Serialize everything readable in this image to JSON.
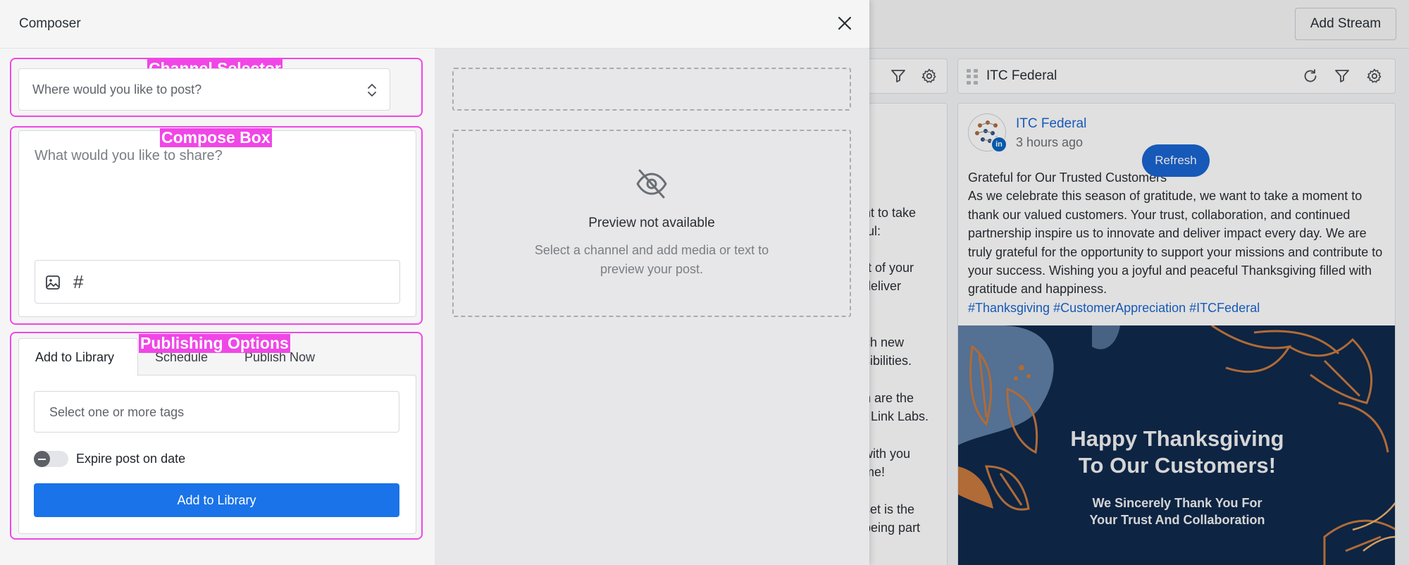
{
  "background": {
    "add_stream_label": "Add Stream",
    "column1": {
      "fragments": [
        "nt to take",
        "ful:",
        "rt of your",
        "deliver",
        "ch new",
        "sibilities.",
        "n are the",
        "f Link Labs.",
        "with you",
        "me!",
        "set is the",
        "being part"
      ]
    },
    "column2": {
      "title": "ITC Federal",
      "post": {
        "author": "ITC Federal",
        "time": "3 hours ago",
        "title": "Grateful for Our Trusted Customers",
        "body": "As we celebrate this season of gratitude, we want to take a moment to thank our valued customers. Your trust, collaboration, and continued partnership inspire us to innovate and deliver impact every day. We are truly grateful for the opportunity to support your missions and contribute to your success. Wishing you a joyful and peaceful Thanksgiving filled with gratitude and happiness.",
        "hashtags": "#Thanksgiving #CustomerAppreciation #ITCFederal",
        "image_line1": "Happy Thanksgiving",
        "image_line2": "To Our Customers!",
        "image_line3": "We Sincerely Thank You For",
        "image_line4": "Your Trust And Collaboration",
        "network_badge": "in"
      },
      "refresh_label": "Refresh"
    }
  },
  "composer": {
    "title": "Composer",
    "channel_selector": {
      "annotation": "Channel Selector",
      "placeholder": "Where would you like to post?"
    },
    "compose_box": {
      "annotation": "Compose Box",
      "placeholder": "What would you like to share?",
      "hash_symbol": "#"
    },
    "publishing_options": {
      "annotation": "Publishing Options",
      "tabs": [
        {
          "label": "Add to Library",
          "active": true
        },
        {
          "label": "Schedule",
          "active": false
        },
        {
          "label": "Publish Now",
          "active": false
        }
      ],
      "tags_placeholder": "Select one or more tags",
      "expire_label": "Expire post on date",
      "expire_enabled": false,
      "submit_label": "Add to Library"
    },
    "preview": {
      "title": "Preview not available",
      "subtitle": "Select a channel and add media or text to preview your post."
    }
  },
  "colors": {
    "accent": "#1a73e8",
    "link": "#1a66d2",
    "annotation": "#f046e6",
    "image_bg": "#0f2a4d"
  }
}
